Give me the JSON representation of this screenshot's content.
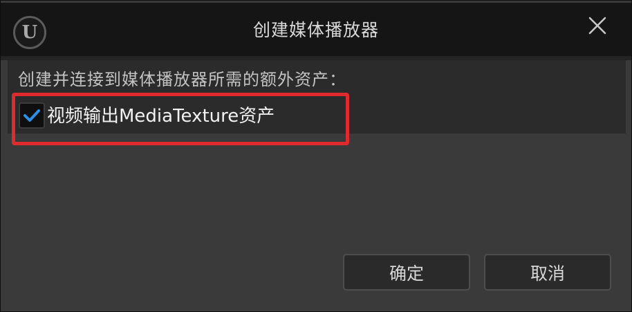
{
  "window": {
    "title": "创建媒体播放器",
    "logo_text": "U",
    "close_icon": "close-icon"
  },
  "content": {
    "description": "创建并连接到媒体播放器所需的额外资产：",
    "option": {
      "label": "视频输出MediaTexture资产",
      "checked": true
    }
  },
  "buttons": {
    "ok_label": "确定",
    "cancel_label": "取消"
  },
  "colors": {
    "accent": "#2f8fe8",
    "highlight": "#e02b2e"
  }
}
